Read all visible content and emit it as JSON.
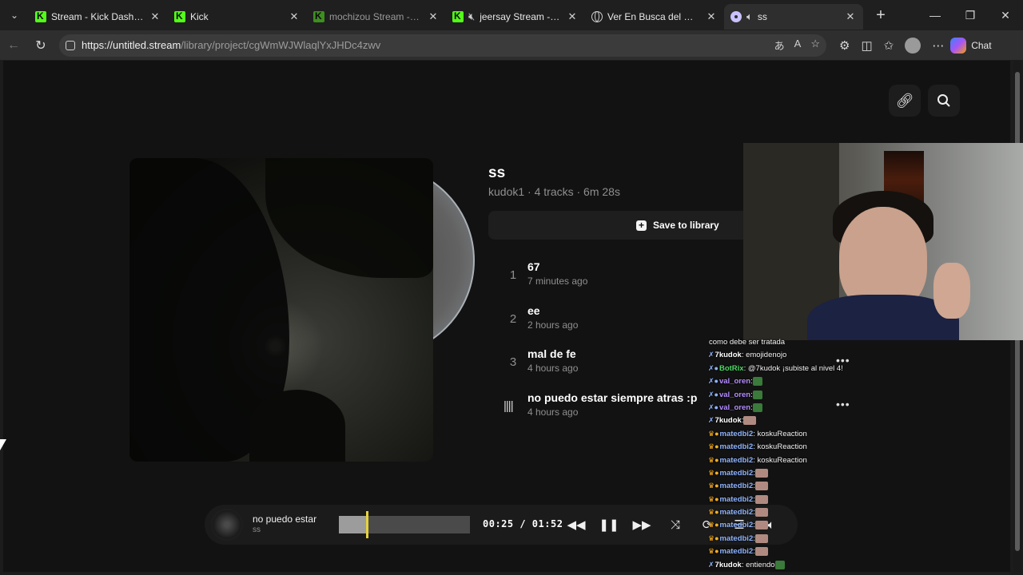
{
  "browser": {
    "tabs": [
      {
        "title": "Stream - Kick Dashboard",
        "icon": "kick-icon",
        "active": false
      },
      {
        "title": "Kick",
        "icon": "kick-icon",
        "active": false
      },
      {
        "title": "mochizou Stream - Wat",
        "icon": "kick-icon",
        "active": false
      },
      {
        "title": "jeersay Stream - Wa",
        "icon": "kick-icon",
        "active": false
      },
      {
        "title": "Ver En Busca del Destin",
        "icon": "globe-icon",
        "active": false
      },
      {
        "title": "ss",
        "icon": "disc-icon",
        "active": true
      }
    ],
    "url_host": "https://untitled.stream",
    "url_path": "/library/project/cgWmWJWlaqlYxJHDc4zwv",
    "chat_label": "Chat"
  },
  "project": {
    "title": "ss",
    "meta": "kudok1 · 4 tracks · 6m 28s",
    "save_label": "Save to library",
    "tracks": [
      {
        "num": "1",
        "name": "67",
        "time": "7 minutes ago"
      },
      {
        "num": "2",
        "name": "ee",
        "time": "2 hours ago"
      },
      {
        "num": "3",
        "name": "mal de fe",
        "time": "4 hours ago"
      },
      {
        "num": "",
        "name": "no puedo estar siempre atras :p",
        "time": "4 hours ago",
        "playing": true
      }
    ]
  },
  "player": {
    "title": "no puedo estar",
    "subtitle": "ss",
    "time": "00:25 / 01:52",
    "progress": 0.22
  },
  "chat": [
    {
      "prefix": "",
      "user": "",
      "text": "como debe ser tratada",
      "color": "#f2f2f2"
    },
    {
      "prefix": "✗",
      "user": "7kudok",
      "text": ": emojidenojo",
      "color": "#ffffff"
    },
    {
      "prefix": "✗●",
      "user": "BotRix",
      "text": ": @7kudok ¡subiste al nivel 4!",
      "color": "#4cd964"
    },
    {
      "prefix": "✗●",
      "user": "val_oren",
      "text": ":",
      "color": "#b48cff",
      "emote": "green"
    },
    {
      "prefix": "✗●",
      "user": "val_oren",
      "text": ":",
      "color": "#b48cff",
      "emote": "green"
    },
    {
      "prefix": "✗●",
      "user": "val_oren",
      "text": ":",
      "color": "#b48cff",
      "emote": "green"
    },
    {
      "prefix": "✗",
      "user": "7kudok",
      "text": ":",
      "color": "#ffffff",
      "emote": "img"
    },
    {
      "prefix": "♛●",
      "user": "matedbi2",
      "text": ": koskuReaction",
      "color": "#8fb4ff"
    },
    {
      "prefix": "♛●",
      "user": "matedbi2",
      "text": ": koskuReaction",
      "color": "#8fb4ff"
    },
    {
      "prefix": "♛●",
      "user": "matedbi2",
      "text": ": koskuReaction",
      "color": "#8fb4ff"
    },
    {
      "prefix": "♛●",
      "user": "matedbi2",
      "text": ":",
      "color": "#8fb4ff",
      "emote": "img"
    },
    {
      "prefix": "♛●",
      "user": "matedbi2",
      "text": ":",
      "color": "#8fb4ff",
      "emote": "img"
    },
    {
      "prefix": "♛●",
      "user": "matedbi2",
      "text": ":",
      "color": "#8fb4ff",
      "emote": "img"
    },
    {
      "prefix": "♛●",
      "user": "matedbi2",
      "text": ":",
      "color": "#8fb4ff",
      "emote": "img"
    },
    {
      "prefix": "♛●",
      "user": "matedbi2",
      "text": ":",
      "color": "#8fb4ff",
      "emote": "img"
    },
    {
      "prefix": "♛●",
      "user": "matedbi2",
      "text": ":",
      "color": "#8fb4ff",
      "emote": "img"
    },
    {
      "prefix": "♛●",
      "user": "matedbi2",
      "text": ":",
      "color": "#8fb4ff",
      "emote": "img"
    },
    {
      "prefix": "✗",
      "user": "7kudok",
      "text": ": entiendo",
      "color": "#ffffff",
      "emote": "green"
    }
  ],
  "colors": {
    "kick_green": "#53fc18",
    "needle": "#e6d23a",
    "page_bg": "#121212"
  }
}
